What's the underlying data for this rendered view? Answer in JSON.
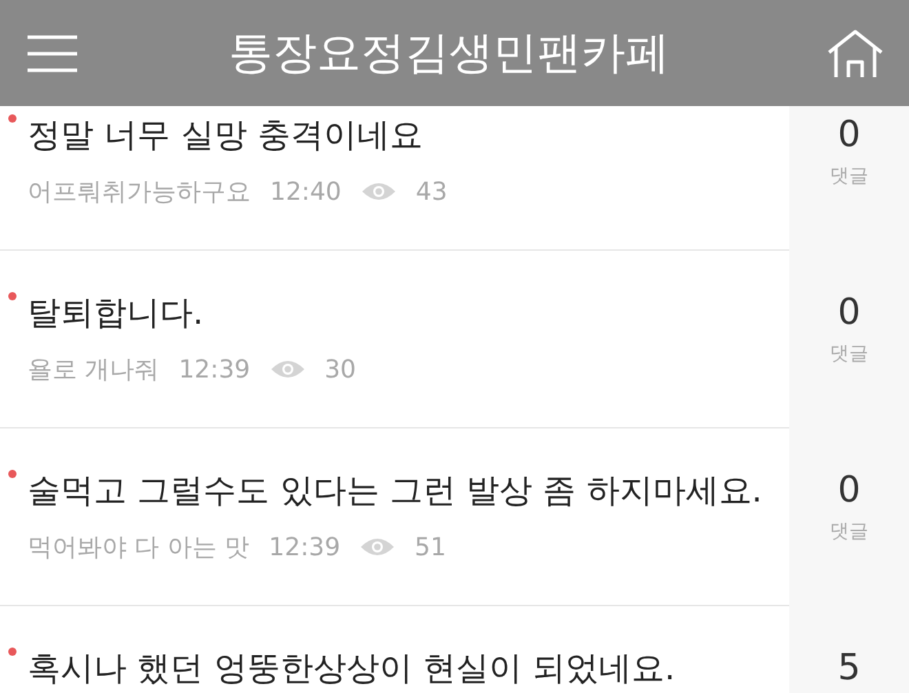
{
  "header": {
    "title": "통장요정김생민팬카페"
  },
  "posts": [
    {
      "title": "정말 너무 실망 충격이네요",
      "new": true,
      "author": "어프뤄취가능하구요",
      "time": "12:40",
      "views": "43",
      "comments": "0",
      "comments_label": "댓글"
    },
    {
      "title": "탈퇴합니다.",
      "new": true,
      "author": "욜로 개나줘",
      "time": "12:39",
      "views": "30",
      "comments": "0",
      "comments_label": "댓글"
    },
    {
      "title": "술먹고 그럴수도 있다는 그런 발상 좀 하지마세요.",
      "new": true,
      "author": "먹어봐야 다 아는 맛",
      "time": "12:39",
      "views": "51",
      "comments": "0",
      "comments_label": "댓글"
    },
    {
      "title": "혹시나 했던 엉뚱한상상이 현실이 되었네요.",
      "new": true,
      "comments": "5"
    }
  ]
}
